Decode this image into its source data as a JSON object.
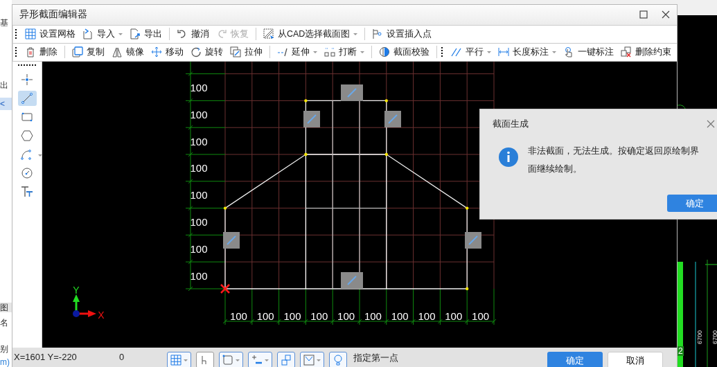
{
  "background_app": {
    "left_texts": [
      "基",
      "出",
      "<",
      "图",
      "名",
      "别",
      "m)"
    ],
    "right_labels": [
      "6700",
      "6700"
    ],
    "right_badge": "2"
  },
  "window": {
    "title": "异形截面编辑器"
  },
  "toolbar_1": [
    {
      "kind": "grip"
    },
    {
      "kind": "button",
      "label": "设置网格",
      "dropdown": false,
      "disabled": false
    },
    {
      "kind": "button",
      "label": "导入",
      "dropdown": true,
      "disabled": false
    },
    {
      "kind": "button",
      "label": "导出",
      "dropdown": false,
      "disabled": false
    },
    {
      "kind": "separator"
    },
    {
      "kind": "button",
      "label": "撤消",
      "dropdown": false,
      "disabled": false
    },
    {
      "kind": "button",
      "label": "恢复",
      "dropdown": false,
      "disabled": true
    },
    {
      "kind": "separator"
    },
    {
      "kind": "button",
      "label": "从CAD选择截面图",
      "dropdown": true,
      "disabled": false
    },
    {
      "kind": "separator"
    },
    {
      "kind": "button",
      "label": "设置插入点",
      "dropdown": false,
      "disabled": false
    }
  ],
  "toolbar_2": [
    {
      "kind": "grip"
    },
    {
      "kind": "button",
      "label": "删除",
      "dropdown": false,
      "disabled": false
    },
    {
      "kind": "separator"
    },
    {
      "kind": "button",
      "label": "复制",
      "dropdown": false,
      "disabled": false
    },
    {
      "kind": "button",
      "label": "镜像",
      "dropdown": false,
      "disabled": false
    },
    {
      "kind": "button",
      "label": "移动",
      "dropdown": false,
      "disabled": false
    },
    {
      "kind": "button",
      "label": "旋转",
      "dropdown": false,
      "disabled": false
    },
    {
      "kind": "button",
      "label": "拉伸",
      "dropdown": false,
      "disabled": false
    },
    {
      "kind": "separator"
    },
    {
      "kind": "button",
      "label": "延伸",
      "dropdown": true,
      "disabled": false
    },
    {
      "kind": "button",
      "label": "打断",
      "dropdown": true,
      "disabled": false
    },
    {
      "kind": "separator"
    },
    {
      "kind": "button",
      "label": "截面校验",
      "dropdown": false,
      "disabled": false
    },
    {
      "kind": "separator"
    },
    {
      "kind": "grip"
    },
    {
      "kind": "button",
      "label": "平行",
      "dropdown": true,
      "disabled": false
    },
    {
      "kind": "button",
      "label": "长度标注",
      "dropdown": true,
      "disabled": false
    },
    {
      "kind": "button",
      "label": "一键标注",
      "dropdown": false,
      "disabled": false
    },
    {
      "kind": "button",
      "label": "删除约束",
      "dropdown": false,
      "disabled": false
    }
  ],
  "draw_tools": [
    {
      "selected": false,
      "dropdown": false
    },
    {
      "selected": true,
      "dropdown": false
    },
    {
      "selected": false,
      "dropdown": false
    },
    {
      "selected": false,
      "dropdown": false
    },
    {
      "selected": false,
      "dropdown": true
    },
    {
      "selected": false,
      "dropdown": false
    },
    {
      "selected": false,
      "dropdown": false
    }
  ],
  "canvas": {
    "left_dimensions": [
      "100",
      "100",
      "100",
      "100",
      "100",
      "100",
      "100",
      "100"
    ],
    "bottom_dimensions": [
      "100",
      "100",
      "100",
      "100",
      "100",
      "100",
      "100",
      "100",
      "100",
      "100"
    ],
    "axis_x": "X",
    "axis_y": "Y"
  },
  "status_bar": {
    "coordinates": "X=1601 Y=-220",
    "value": "0",
    "tools": [
      {
        "kind": "button",
        "dropdown": true
      },
      {
        "kind": "box",
        "dropdown": false
      },
      {
        "kind": "button",
        "dropdown": true
      },
      {
        "kind": "button",
        "dropdown": true
      },
      {
        "kind": "button",
        "dropdown": false
      },
      {
        "kind": "button",
        "dropdown": true
      },
      {
        "kind": "button",
        "dropdown": false
      }
    ],
    "prompt": "指定第一点",
    "ok": "确定",
    "cancel": "取消"
  },
  "dialog": {
    "title": "截面生成",
    "message": "非法截面，无法生成。按确定返回原绘制界面继续绘制。",
    "ok": "确定"
  }
}
